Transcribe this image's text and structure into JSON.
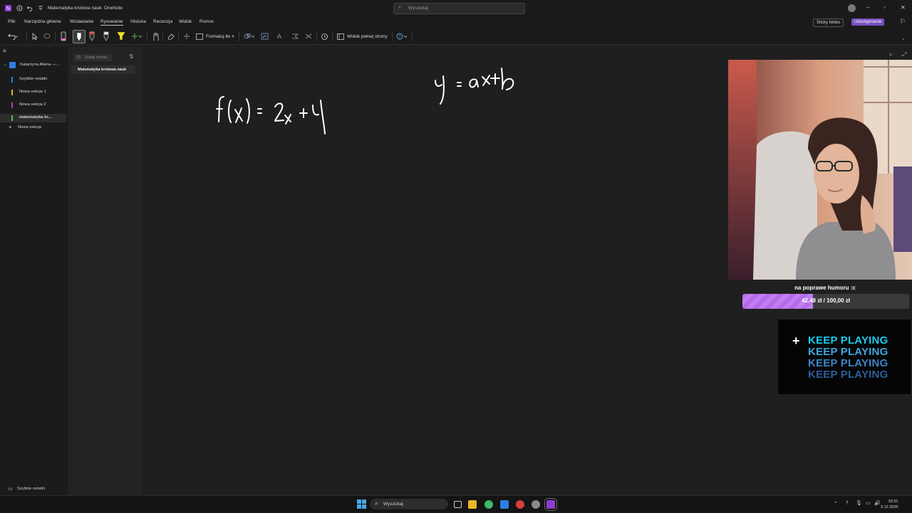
{
  "titlebar": {
    "title": "Matematyka krolowa nauk",
    "app": "OneNote",
    "search_placeholder": "Wyszukaj"
  },
  "menu": {
    "items": [
      "Plik",
      "Narzędzia główne",
      "Wstawianie",
      "Rysowanie",
      "Historia",
      "Recenzja",
      "Widok",
      "Pomoc"
    ],
    "active": "Rysowanie",
    "sticky_notes": "Sticky Notes",
    "share": "Udostępnianie"
  },
  "ribbon": {
    "format_label": "Formatuj tło",
    "fullpage_label": "Widok pełnej strony"
  },
  "nav": {
    "notebook": "Katarzyna Aliena —...",
    "sections": [
      {
        "label": "Szybkie notatki",
        "color": "#3d7de0"
      },
      {
        "label": "Nowa sekcja 1",
        "color": "#e8b41c"
      },
      {
        "label": "Nowa sekcja 2",
        "color": "#c83fb8"
      },
      {
        "label": "matematyka kr...",
        "color": "#4cc35a"
      }
    ],
    "new_section": "Nowa sekcja",
    "footer": "Szybkie notatki"
  },
  "pages": {
    "add_page": "Dodaj stronę",
    "items": [
      "Matematyka krolowa nauk"
    ]
  },
  "canvas": {
    "ink_text_1": "f(x) = 2x + y",
    "ink_text_2": "y = ax + b"
  },
  "overlay": {
    "goal_title": "na poprawe humoru :c",
    "goal_amount": "42,48 zł / 100,00 zł",
    "goal_fraction": 0.4248,
    "keep_playing": "KEEP PLAYING",
    "keep_playing_colors": [
      "#1ec8f0",
      "#3ea6de",
      "#3b86c6",
      "#2c5f9a"
    ]
  },
  "taskbar": {
    "search": "Wyszukaj",
    "time": "23:31",
    "date": "3.12.2025"
  }
}
